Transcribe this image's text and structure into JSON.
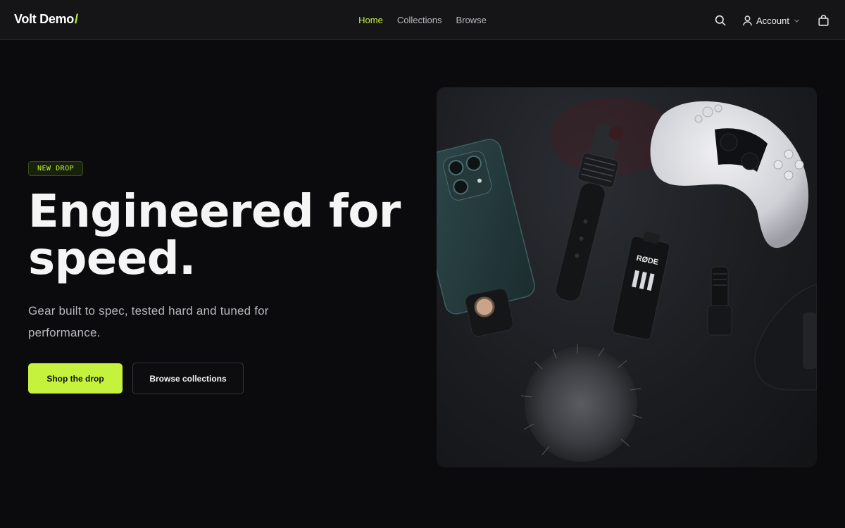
{
  "header": {
    "logo_text": "Volt Demo",
    "logo_mark": "/",
    "nav": [
      {
        "label": "Home",
        "active": true
      },
      {
        "label": "Collections",
        "active": false
      },
      {
        "label": "Browse",
        "active": false
      }
    ],
    "search_icon": "search-icon",
    "account_label": "Account",
    "account_icon": "user-icon",
    "cart_icon": "shopping-bag-icon"
  },
  "hero": {
    "badge": "NEW DROP",
    "headline": "Engineered for speed.",
    "subtitle": "Gear built to spec, tested hard and tuned for performance.",
    "primary_cta": "Shop the drop",
    "secondary_cta": "Browse collections",
    "image": {
      "product_brand_text": "RØDE"
    }
  },
  "theme": {
    "accent": "#c5f23c",
    "background": "#0b0b0d",
    "header_bg": "#151517"
  }
}
